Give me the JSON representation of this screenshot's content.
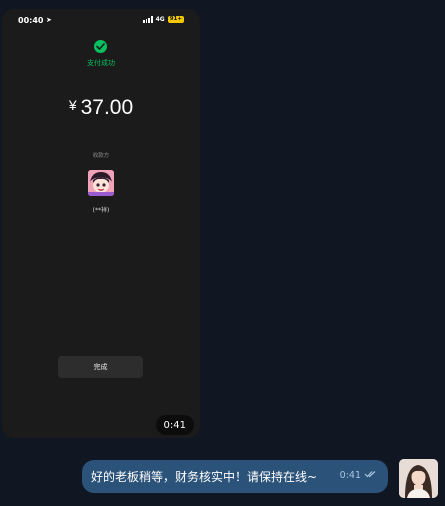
{
  "chat": {
    "media_message": {
      "status_bar": {
        "time": "00:40",
        "location_glyph": "➤",
        "network": "4G",
        "battery": "91+"
      },
      "payment": {
        "status": "支付成功",
        "currency": "¥",
        "amount": "37.00",
        "payee_label": "收款方",
        "payee_name": "(**祥)",
        "done_label": "完成"
      },
      "timestamp": "0:41"
    },
    "text_message": {
      "text": "好的老板稍等，财务核实中！请保持在线~",
      "timestamp": "0:41",
      "read_icon": "double-check-icon"
    }
  },
  "colors": {
    "background": "#101722",
    "bubble_outgoing": "#2b5278",
    "success_green": "#07c160",
    "battery_yellow": "#f2c800"
  }
}
